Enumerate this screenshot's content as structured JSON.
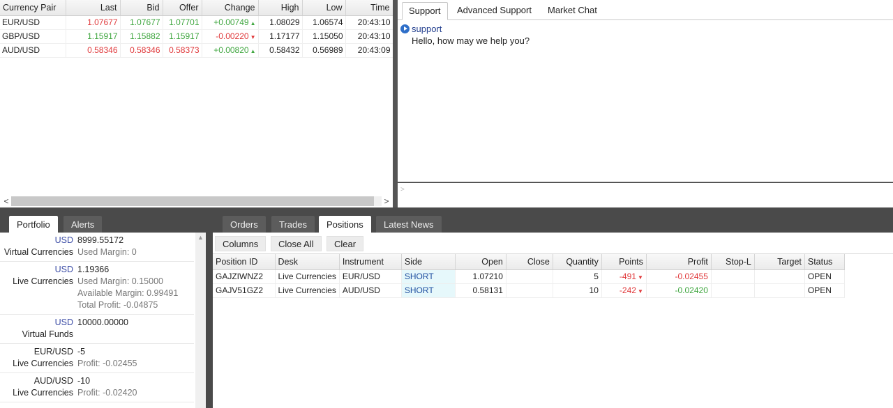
{
  "quotes": {
    "columns": [
      "Currency Pair",
      "Last",
      "Bid",
      "Offer",
      "Change",
      "High",
      "Low",
      "Time"
    ],
    "rows": [
      {
        "pair": "EUR/USD",
        "last": "1.07677",
        "bid": "1.07677",
        "offer": "1.07701",
        "change": "+0.00749",
        "high": "1.08029",
        "low": "1.06574",
        "time": "20:43:10"
      },
      {
        "pair": "GBP/USD",
        "last": "1.15917",
        "bid": "1.15882",
        "offer": "1.15917",
        "change": "-0.00220",
        "high": "1.17177",
        "low": "1.15050",
        "time": "20:43:10"
      },
      {
        "pair": "AUD/USD",
        "last": "0.58346",
        "bid": "0.58346",
        "offer": "0.58373",
        "change": "+0.00820",
        "high": "0.58432",
        "low": "0.56989",
        "time": "20:43:09"
      }
    ],
    "up_arrow": "▲",
    "down_arrow": "▼",
    "scroll_left": "<",
    "scroll_right": ">"
  },
  "chat": {
    "tabs": [
      "Support",
      "Advanced Support",
      "Market Chat"
    ],
    "active_tab": "Support",
    "message": {
      "sender": "support",
      "text": "Hello, how may we help you?"
    },
    "input_prompt": ">"
  },
  "portfolio": {
    "tabs": [
      "Portfolio",
      "Alerts"
    ],
    "active_tab": "Portfolio",
    "entries": [
      {
        "currency": "USD",
        "label": "Virtual Currencies",
        "value": "8999.55172",
        "details": [
          "Used Margin:  0"
        ]
      },
      {
        "currency": "USD",
        "label": "Live Currencies",
        "value": "1.19366",
        "details": [
          "Used Margin:  0.15000",
          "Available Margin:  0.99491",
          "Total Profit:  -0.04875"
        ]
      },
      {
        "currency": "USD",
        "label": "Virtual Funds",
        "value": "10000.00000",
        "details": []
      },
      {
        "currency": "EUR/USD",
        "label": "Live Currencies",
        "value": "-5",
        "details": [
          "Profit:  -0.02455"
        ]
      },
      {
        "currency": "AUD/USD",
        "label": "Live Currencies",
        "value": "-10",
        "details": [
          "Profit:  -0.02420"
        ]
      }
    ],
    "scroll_up": "▲"
  },
  "orders": {
    "tabs": [
      "Orders",
      "Trades",
      "Positions",
      "Latest News"
    ],
    "active_tab": "Positions",
    "toolbar": {
      "columns": "Columns",
      "close_all": "Close All",
      "clear": "Clear"
    },
    "columns": [
      "Position ID",
      "Desk",
      "Instrument",
      "Side",
      "Open",
      "Close",
      "Quantity",
      "Points",
      "Profit",
      "Stop-L",
      "Target",
      "Status"
    ],
    "rows": [
      {
        "id": "GAJZIWNZ2",
        "desk": "Live Currencies",
        "instrument": "EUR/USD",
        "side": "SHORT",
        "open": "1.07210",
        "close": "",
        "quantity": "5",
        "points": "-491",
        "profit": "-0.02455",
        "stop": "",
        "target": "",
        "status": "OPEN"
      },
      {
        "id": "GAJV51GZ2",
        "desk": "Live Currencies",
        "instrument": "AUD/USD",
        "side": "SHORT",
        "open": "0.58131",
        "close": "",
        "quantity": "10",
        "points": "-242",
        "profit": "-0.02420",
        "stop": "",
        "target": "",
        "status": "OPEN"
      }
    ]
  },
  "colors": {
    "up": "#3fa63f",
    "down": "#e0393b",
    "link_blue": "#3a4ba5",
    "splitter": "#4a4a4a"
  }
}
